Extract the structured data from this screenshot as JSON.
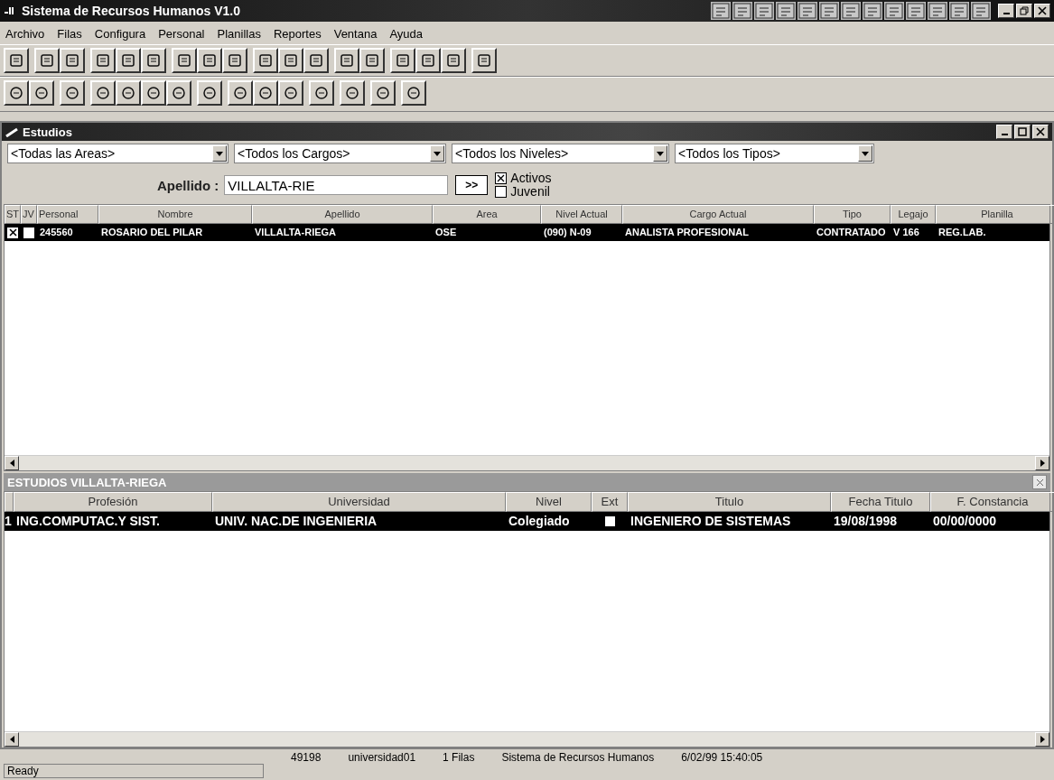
{
  "window": {
    "title": "Sistema de Recursos Humanos  V1.0"
  },
  "menu": [
    "Archivo",
    "Filas",
    "Configura",
    "Personal",
    "Planillas",
    "Reportes",
    "Ventana",
    "Ayuda"
  ],
  "child_window": {
    "title": "Estudios"
  },
  "filters": [
    {
      "value": "<Todas las Areas>"
    },
    {
      "value": "<Todos los Cargos>"
    },
    {
      "value": "<Todos los Niveles>"
    },
    {
      "value": "<Todos los Tipos>"
    }
  ],
  "search": {
    "label": "Apellido :",
    "value": "VILLALTA-RIE",
    "button": ">>"
  },
  "checkboxes": [
    {
      "label": "Activos",
      "checked": true
    },
    {
      "label": "Juvenil",
      "checked": false
    }
  ],
  "personal_table": {
    "columns": [
      "ST",
      "JV",
      "Personal",
      "Nombre",
      "Apellido",
      "Area",
      "Nivel Actual",
      "Cargo Actual",
      "Tipo",
      "Legajo",
      "Planilla"
    ],
    "rows": [
      {
        "selected": true,
        "st": true,
        "jv": false,
        "cells": [
          "",
          "",
          "245560",
          "ROSARIO DEL PILAR",
          "VILLALTA-RIEGA",
          "OSE",
          "(090)  N-09",
          "ANALISTA PROFESIONAL",
          "CONTRATADO",
          "V 166",
          "REG.LAB."
        ]
      }
    ]
  },
  "studies_panel": {
    "title": "ESTUDIOS VILLALTA-RIEGA",
    "columns": [
      "Profesión",
      "Universidad",
      "Nivel",
      "Ext",
      "Titulo",
      "Fecha Titulo",
      "F. Constancia"
    ],
    "rows": [
      {
        "selected": true,
        "number": "1",
        "ext": false,
        "cells": [
          "ING.COMPUTAC.Y SIST.",
          "UNIV. NAC.DE INGENIERIA",
          "Colegiado",
          "",
          "INGENIERO DE SISTEMAS",
          "19/08/1998",
          "00/00/0000"
        ]
      }
    ]
  },
  "status_bar": {
    "message": "Ready",
    "fields": [
      "49198",
      "universidad01",
      "1 Filas",
      "Sistema de Recursos Humanos",
      "6/02/99 15:40:05"
    ]
  }
}
